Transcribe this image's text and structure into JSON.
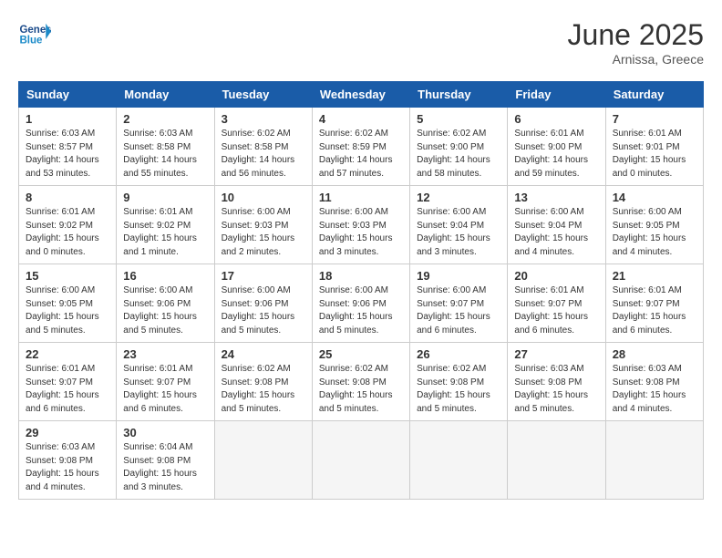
{
  "header": {
    "logo_line1": "General",
    "logo_line2": "Blue",
    "month_title": "June 2025",
    "location": "Arnissa, Greece"
  },
  "weekdays": [
    "Sunday",
    "Monday",
    "Tuesday",
    "Wednesday",
    "Thursday",
    "Friday",
    "Saturday"
  ],
  "days": [
    {
      "num": "1",
      "sunrise": "6:03 AM",
      "sunset": "8:57 PM",
      "daylight": "14 hours and 53 minutes."
    },
    {
      "num": "2",
      "sunrise": "6:03 AM",
      "sunset": "8:58 PM",
      "daylight": "14 hours and 55 minutes."
    },
    {
      "num": "3",
      "sunrise": "6:02 AM",
      "sunset": "8:58 PM",
      "daylight": "14 hours and 56 minutes."
    },
    {
      "num": "4",
      "sunrise": "6:02 AM",
      "sunset": "8:59 PM",
      "daylight": "14 hours and 57 minutes."
    },
    {
      "num": "5",
      "sunrise": "6:02 AM",
      "sunset": "9:00 PM",
      "daylight": "14 hours and 58 minutes."
    },
    {
      "num": "6",
      "sunrise": "6:01 AM",
      "sunset": "9:00 PM",
      "daylight": "14 hours and 59 minutes."
    },
    {
      "num": "7",
      "sunrise": "6:01 AM",
      "sunset": "9:01 PM",
      "daylight": "15 hours and 0 minutes."
    },
    {
      "num": "8",
      "sunrise": "6:01 AM",
      "sunset": "9:02 PM",
      "daylight": "15 hours and 0 minutes."
    },
    {
      "num": "9",
      "sunrise": "6:01 AM",
      "sunset": "9:02 PM",
      "daylight": "15 hours and 1 minute."
    },
    {
      "num": "10",
      "sunrise": "6:00 AM",
      "sunset": "9:03 PM",
      "daylight": "15 hours and 2 minutes."
    },
    {
      "num": "11",
      "sunrise": "6:00 AM",
      "sunset": "9:03 PM",
      "daylight": "15 hours and 3 minutes."
    },
    {
      "num": "12",
      "sunrise": "6:00 AM",
      "sunset": "9:04 PM",
      "daylight": "15 hours and 3 minutes."
    },
    {
      "num": "13",
      "sunrise": "6:00 AM",
      "sunset": "9:04 PM",
      "daylight": "15 hours and 4 minutes."
    },
    {
      "num": "14",
      "sunrise": "6:00 AM",
      "sunset": "9:05 PM",
      "daylight": "15 hours and 4 minutes."
    },
    {
      "num": "15",
      "sunrise": "6:00 AM",
      "sunset": "9:05 PM",
      "daylight": "15 hours and 5 minutes."
    },
    {
      "num": "16",
      "sunrise": "6:00 AM",
      "sunset": "9:06 PM",
      "daylight": "15 hours and 5 minutes."
    },
    {
      "num": "17",
      "sunrise": "6:00 AM",
      "sunset": "9:06 PM",
      "daylight": "15 hours and 5 minutes."
    },
    {
      "num": "18",
      "sunrise": "6:00 AM",
      "sunset": "9:06 PM",
      "daylight": "15 hours and 5 minutes."
    },
    {
      "num": "19",
      "sunrise": "6:00 AM",
      "sunset": "9:07 PM",
      "daylight": "15 hours and 6 minutes."
    },
    {
      "num": "20",
      "sunrise": "6:01 AM",
      "sunset": "9:07 PM",
      "daylight": "15 hours and 6 minutes."
    },
    {
      "num": "21",
      "sunrise": "6:01 AM",
      "sunset": "9:07 PM",
      "daylight": "15 hours and 6 minutes."
    },
    {
      "num": "22",
      "sunrise": "6:01 AM",
      "sunset": "9:07 PM",
      "daylight": "15 hours and 6 minutes."
    },
    {
      "num": "23",
      "sunrise": "6:01 AM",
      "sunset": "9:07 PM",
      "daylight": "15 hours and 6 minutes."
    },
    {
      "num": "24",
      "sunrise": "6:02 AM",
      "sunset": "9:08 PM",
      "daylight": "15 hours and 5 minutes."
    },
    {
      "num": "25",
      "sunrise": "6:02 AM",
      "sunset": "9:08 PM",
      "daylight": "15 hours and 5 minutes."
    },
    {
      "num": "26",
      "sunrise": "6:02 AM",
      "sunset": "9:08 PM",
      "daylight": "15 hours and 5 minutes."
    },
    {
      "num": "27",
      "sunrise": "6:03 AM",
      "sunset": "9:08 PM",
      "daylight": "15 hours and 5 minutes."
    },
    {
      "num": "28",
      "sunrise": "6:03 AM",
      "sunset": "9:08 PM",
      "daylight": "15 hours and 4 minutes."
    },
    {
      "num": "29",
      "sunrise": "6:03 AM",
      "sunset": "9:08 PM",
      "daylight": "15 hours and 4 minutes."
    },
    {
      "num": "30",
      "sunrise": "6:04 AM",
      "sunset": "9:08 PM",
      "daylight": "15 hours and 3 minutes."
    }
  ]
}
